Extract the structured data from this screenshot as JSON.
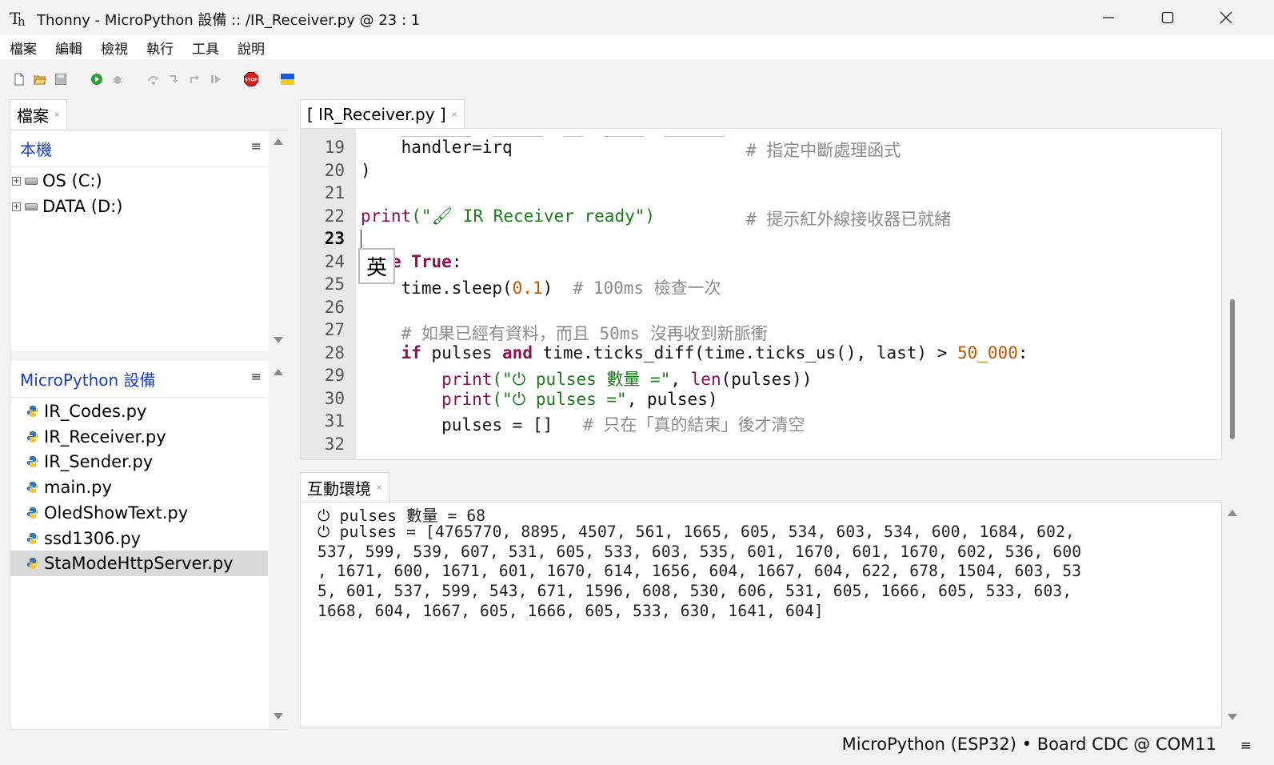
{
  "window": {
    "title": "Thonny  -  MicroPython 設備 :: /IR_Receiver.py  @  23 : 1",
    "minimize_glyph": "—",
    "maximize_glyph": "☐",
    "close_glyph": "✕"
  },
  "menu": [
    "檔案",
    "編輯",
    "檢視",
    "執行",
    "工具",
    "說明"
  ],
  "toolbar": {
    "icons": [
      "new-file-icon",
      "open-file-icon",
      "save-file-icon",
      "run-icon",
      "debug-icon",
      "step-over-icon",
      "step-into-icon",
      "step-out-icon",
      "resume-icon",
      "stop-icon",
      "ukraine-flag-icon"
    ],
    "stop_label": "STOP"
  },
  "files_panel": {
    "tab_label": "檔案",
    "tab_close": "×",
    "local_section": {
      "title": "本機",
      "menu_glyph": "≡",
      "items": [
        {
          "label": "OS (C:)"
        },
        {
          "label": "DATA (D:)"
        }
      ]
    },
    "device_section": {
      "title": "MicroPython 設備",
      "menu_glyph": "≡",
      "items": [
        {
          "label": "IR_Codes.py"
        },
        {
          "label": "IR_Receiver.py"
        },
        {
          "label": "IR_Sender.py"
        },
        {
          "label": "main.py"
        },
        {
          "label": "OledShowText.py"
        },
        {
          "label": "ssd1306.py"
        },
        {
          "label": "StaModeHttpServer.py",
          "selected": true
        }
      ]
    }
  },
  "editor": {
    "tab_label": "[ IR_Receiver.py ]",
    "tab_close": "×",
    "current_line": 23,
    "line_numbers": [
      "19",
      "20",
      "21",
      "22",
      "23",
      "24",
      "25",
      "26",
      "27",
      "28",
      "29",
      "30",
      "31",
      "32"
    ],
    "ime_indicator": "英",
    "code": {
      "l19_code": "    handler=irq",
      "l19_comment": "# 指定中斷處理函式",
      "l20": ")",
      "l22_fn": "print",
      "l22_str": "(\"🖌 IR Receiver ready\")",
      "l22_comment": "# 提示紅外線接收器已就緒",
      "l24_kw": "le True",
      "l24_tail": ":",
      "l25_a": "    time.sleep(",
      "l25_num": "0.1",
      "l25_b": ")  ",
      "l25_comment": "# 100ms 檢查一次",
      "l27_comment": "    # 如果已經有資料，而且 50ms 沒再收到新脈衝",
      "l28_if": "if",
      "l28_a": " pulses ",
      "l28_and": "and",
      "l28_b": " time.ticks_diff(time.ticks_us(), last) > ",
      "l28_num": "50_000",
      "l28_c": ":",
      "l29_fn": "print",
      "l29_str": "(\"⏻ pulses 數量 =\"",
      "l29_mid": ", ",
      "l29_len": "len",
      "l29_tail": "(pulses))",
      "l30_fn": "print",
      "l30_str": "(\"⏻ pulses =\"",
      "l30_tail": ", pulses)",
      "l31_code": "        pulses = []   ",
      "l31_comment": "# 只在「真的結束」後才清空"
    }
  },
  "shell": {
    "tab_label": "互動環境",
    "tab_close": "×",
    "lines": [
      "⏻ pulses 數量 = 68",
      "⏻ pulses = [4765770, 8895, 4507, 561, 1665, 605, 534, 603, 534, 600, 1684, 602,",
      "537, 599, 539, 607, 531, 605, 533, 603, 535, 601, 1670, 601, 1670, 602, 536, 600",
      ", 1671, 600, 1671, 601, 1670, 614, 1656, 604, 1667, 604, 622, 678, 1504, 603, 53",
      "5, 601, 537, 599, 543, 671, 1596, 608, 530, 606, 531, 605, 1666, 605, 533, 603,",
      "1668, 604, 1667, 605, 1666, 605, 533, 630, 1641, 604]"
    ]
  },
  "statusbar": {
    "text": "MicroPython (ESP32)  •  Board CDC @ COM11",
    "menu_glyph": "≡"
  }
}
